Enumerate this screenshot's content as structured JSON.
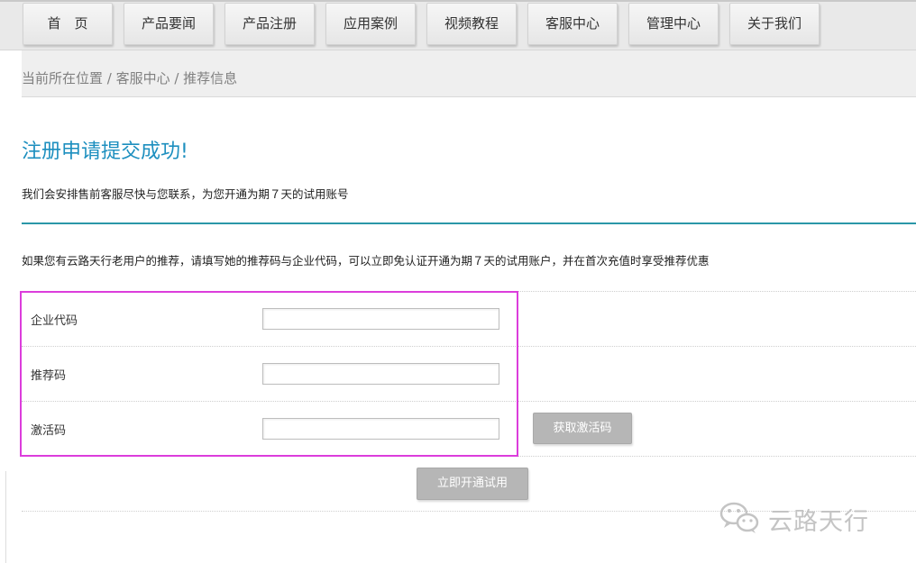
{
  "nav": {
    "items": [
      {
        "label": "首　页"
      },
      {
        "label": "产品要闻"
      },
      {
        "label": "产品注册"
      },
      {
        "label": "应用案例"
      },
      {
        "label": "视频教程"
      },
      {
        "label": "客服中心"
      },
      {
        "label": "管理中心"
      },
      {
        "label": "关于我们"
      }
    ]
  },
  "breadcrumb": "当前所在位置 / 客服中心 / 推荐信息",
  "success": {
    "title": "注册申请提交成功!",
    "description": "我们会安排售前客服尽快与您联系，为您开通为期７天的试用账号"
  },
  "referral_note": "如果您有云路天行老用户的推荐，请填写她的推荐码与企业代码，可以立即免认证开通为期７天的试用账户，并在首次充值时享受推荐优惠",
  "form": {
    "company_code": {
      "label": "企业代码",
      "value": ""
    },
    "referral_code": {
      "label": "推荐码",
      "value": ""
    },
    "activation_code": {
      "label": "激活码",
      "value": ""
    },
    "get_activation_button": "获取激活码",
    "submit_button": "立即开通试用"
  },
  "watermark": {
    "icon": "wechat-icon",
    "text": "云路天行"
  },
  "colors": {
    "title_accent": "#1d8fbf",
    "divider": "#2a97a8",
    "highlight_border": "#dc3ddc",
    "button_gray": "#b6b6b6"
  }
}
